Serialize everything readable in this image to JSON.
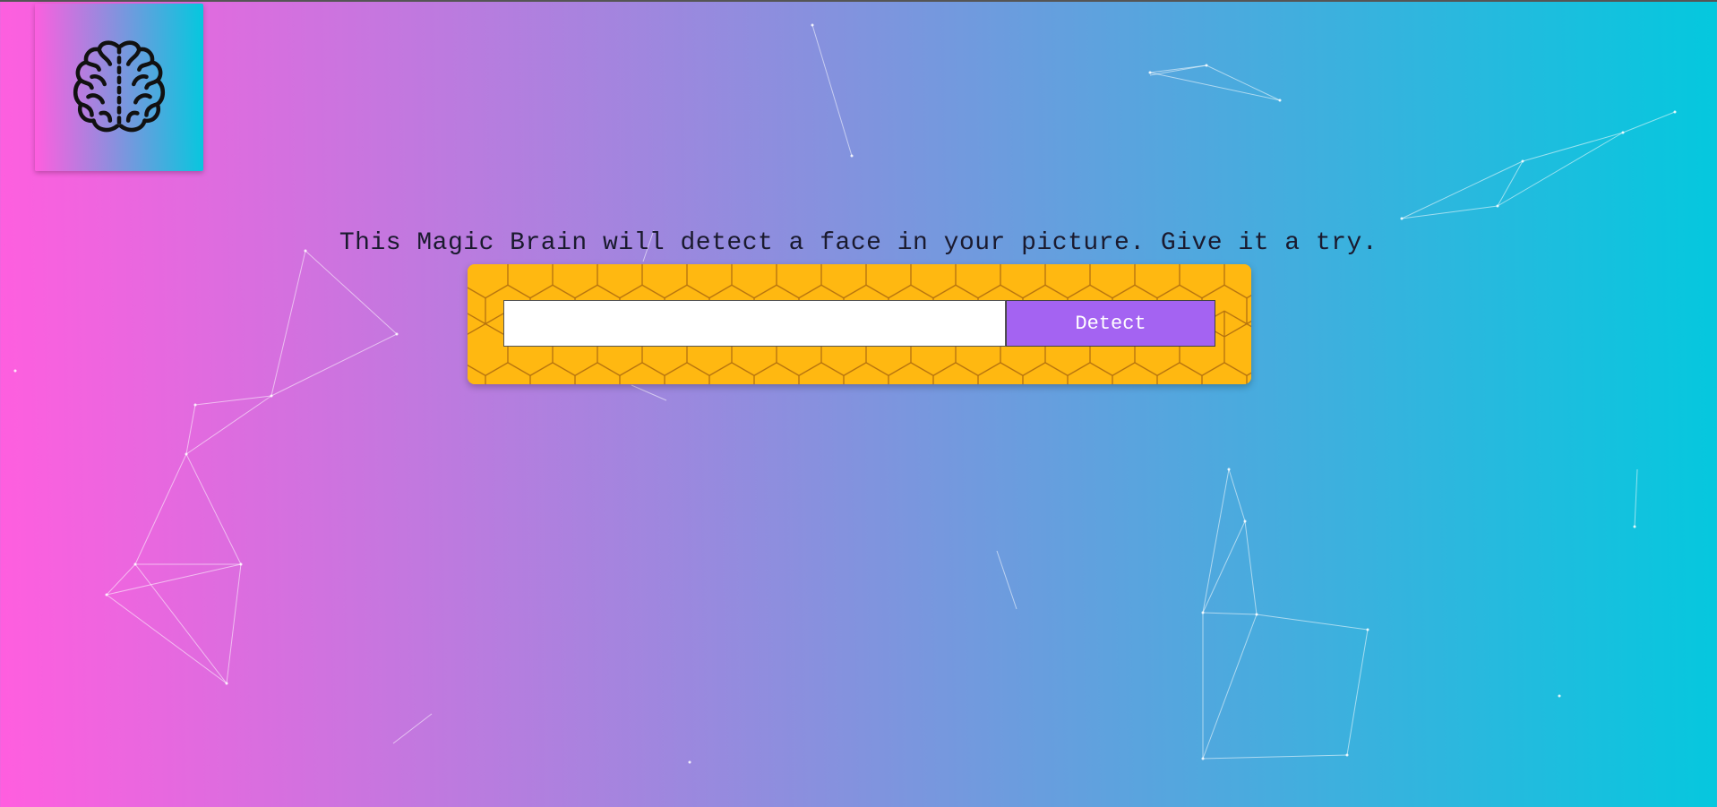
{
  "logo": {
    "icon": "brain-icon"
  },
  "headline": "This Magic Brain will detect a face in your picture. Give it a try.",
  "image_url_input": {
    "value": "",
    "placeholder": ""
  },
  "detect_button": {
    "label": "Detect"
  },
  "colors": {
    "gradient_start": "#ff5edf",
    "gradient_end": "#04c8de",
    "panel_background": "#ffb811",
    "button_background": "#a463f2"
  }
}
